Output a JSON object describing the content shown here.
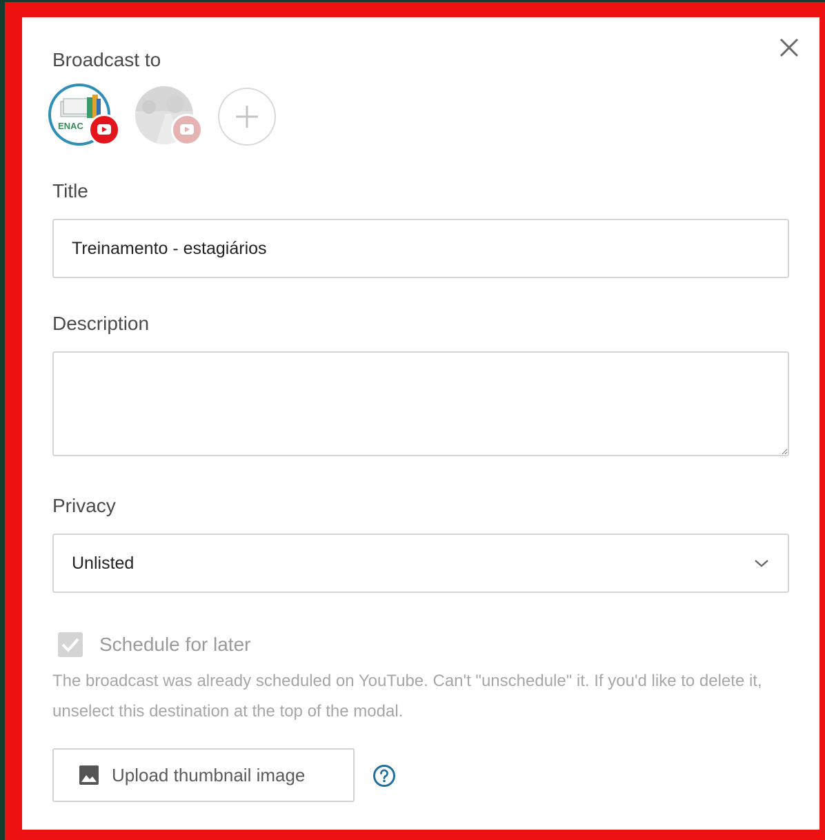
{
  "modal": {
    "broadcast_label": "Broadcast to",
    "destinations": [
      {
        "avatar_text": "ENAC",
        "platform": "youtube",
        "selected": true
      },
      {
        "avatar_text": "",
        "platform": "youtube",
        "selected": false
      }
    ],
    "title_label": "Title",
    "title_value": "Treinamento - estagiários",
    "description_label": "Description",
    "description_value": "",
    "privacy_label": "Privacy",
    "privacy_value": "Unlisted",
    "schedule_label": "Schedule for later",
    "schedule_checked": true,
    "schedule_note": "The broadcast was already scheduled on YouTube. Can't \"unschedule\" it. If you'd like to delete it, unselect this destination at the top of the modal.",
    "upload_label": "Upload thumbnail image"
  },
  "colors": {
    "highlight_border": "#ee1111",
    "youtube_red": "#e3141b",
    "avatar_ring": "#2f8fb7",
    "help_icon": "#1f6f9f"
  },
  "icons": [
    "close-icon",
    "plus-icon",
    "youtube-icon",
    "chevron-down-icon",
    "checkmark-icon",
    "image-icon",
    "help-icon"
  ]
}
